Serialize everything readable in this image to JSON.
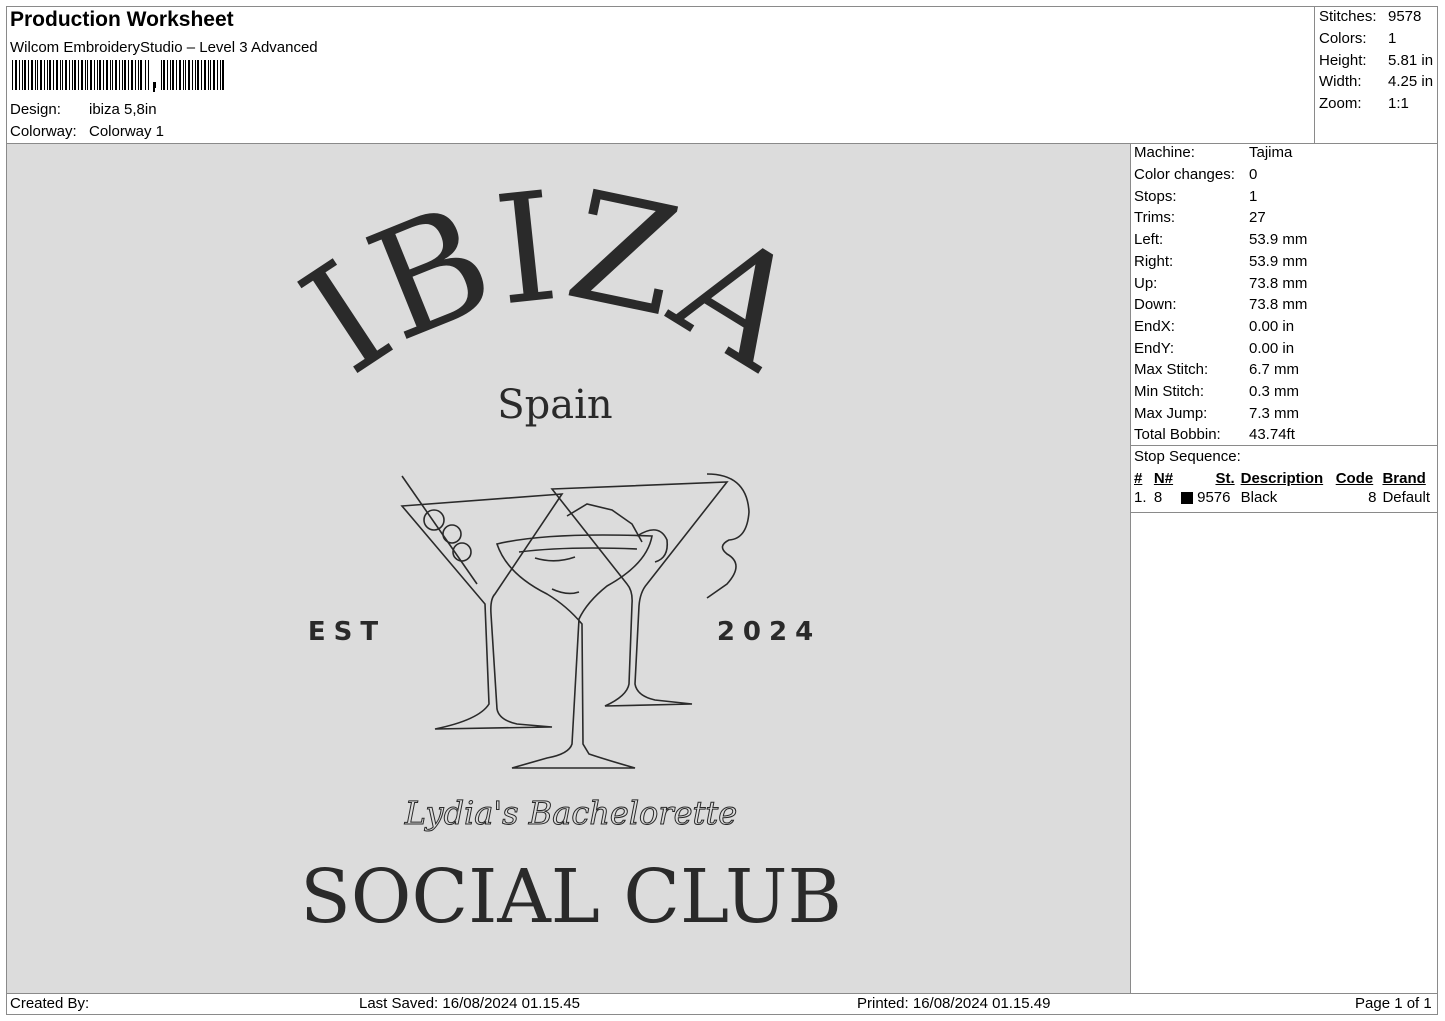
{
  "header": {
    "title": "Production Worksheet",
    "software": "Wilcom EmbroideryStudio – Level 3 Advanced",
    "design_label": "Design:",
    "design_value": "ibiza 5,8in",
    "colorway_label": "Colorway:",
    "colorway_value": "Colorway 1"
  },
  "summary": [
    {
      "label": "Stitches:",
      "value": "9578"
    },
    {
      "label": "Colors:",
      "value": "1"
    },
    {
      "label": "Height:",
      "value": "5.81 in"
    },
    {
      "label": "Width:",
      "value": "4.25 in"
    },
    {
      "label": "Zoom:",
      "value": "1:1"
    }
  ],
  "details": [
    {
      "label": "Machine:",
      "value": "Tajima"
    },
    {
      "label": "Color changes:",
      "value": "0"
    },
    {
      "label": "Stops:",
      "value": "1"
    },
    {
      "label": "Trims:",
      "value": "27"
    },
    {
      "label": "Left:",
      "value": "53.9 mm"
    },
    {
      "label": "Right:",
      "value": "53.9 mm"
    },
    {
      "label": "Up:",
      "value": "73.8 mm"
    },
    {
      "label": "Down:",
      "value": "73.8 mm"
    },
    {
      "label": "EndX:",
      "value": "0.00 in"
    },
    {
      "label": "EndY:",
      "value": "0.00 in"
    },
    {
      "label": "Max Stitch:",
      "value": "6.7 mm"
    },
    {
      "label": "Min Stitch:",
      "value": "0.3 mm"
    },
    {
      "label": "Max Jump:",
      "value": "7.3 mm"
    },
    {
      "label": "Total Bobbin:",
      "value": "43.74ft"
    }
  ],
  "stop_sequence": {
    "title": "Stop Sequence:",
    "columns": [
      "#",
      "N#",
      "St.",
      "Description",
      "Code",
      "Brand"
    ],
    "rows": [
      {
        "num": "1.",
        "n": "8",
        "st": "9576",
        "description": "Black",
        "code": "8",
        "brand": "Default",
        "color": "#000000"
      }
    ]
  },
  "design": {
    "title": "IBIZA",
    "subtitle": "Spain",
    "est_left": "EST",
    "est_right": "2024",
    "script": "Lydia's Bachelorette",
    "bottom": "SOCIAL CLUB",
    "thread_color": "#2a2a2a"
  },
  "footer": {
    "created_by": "Created By:",
    "last_saved": "Last Saved: 16/08/2024 01.15.45",
    "printed": "Printed: 16/08/2024 01.15.49",
    "page": "Page 1 of 1"
  }
}
